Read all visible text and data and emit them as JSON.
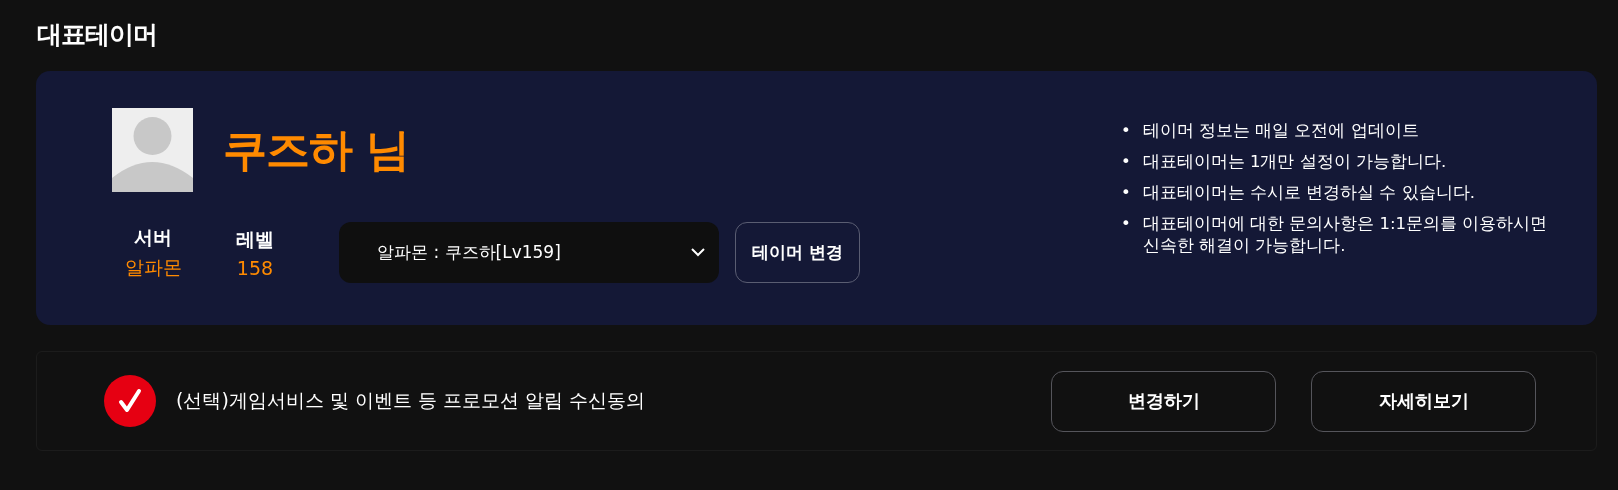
{
  "title": "대표테이머",
  "profile": {
    "name": "쿠즈하 님",
    "server_label": "서버",
    "server": "알파몬",
    "level_label": "레벨",
    "level_value": "158"
  },
  "character_select": {
    "value": "알파몬 : 쿠즈하[Lv159]"
  },
  "change_button": "테이머 변경",
  "notes": [
    {
      "bullet": "•",
      "text": "테이머 정보는 매일 오전에 업데이트"
    },
    {
      "bullet": "•",
      "text": "대표테이머는 1개만 설정이 가능합니다."
    },
    {
      "bullet": "•",
      "text": "대표테이머는 수시로 변경하실 수 있습니다."
    },
    {
      "bullet": "•",
      "text": "대표테이머에 대한 문의사항은 1:1문의를 이용하시면 신속한 해결이 가능합니다."
    }
  ],
  "consent": {
    "checked": true,
    "label": "(선택)게임서비스 및 이벤트 등 프로모션 알림 수신동의"
  },
  "consent_buttons": [
    "변경하기",
    "자세히보기"
  ]
}
